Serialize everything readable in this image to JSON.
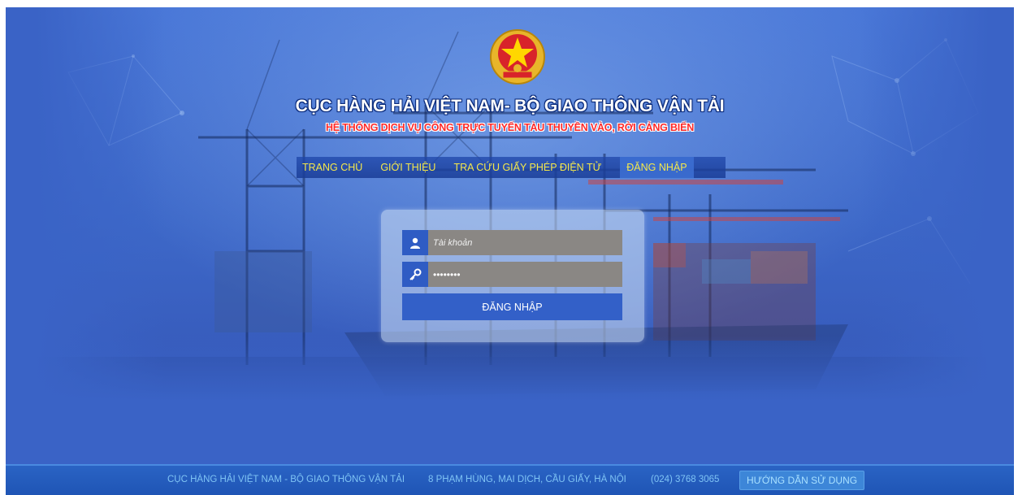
{
  "header": {
    "title": "CỤC HÀNG HẢI VIỆT NAM- BỘ GIAO THÔNG VẬN TẢI",
    "subtitle": "HỆ THỐNG DỊCH VỤ CÔNG TRỰC TUYẾN TÀU THUYỀN VÀO, RỜI CẢNG BIỂN"
  },
  "nav": {
    "items": [
      {
        "label": "TRANG CHỦ"
      },
      {
        "label": "GIỚI THIỆU"
      },
      {
        "label": "TRA CỨU GIẤY PHÉP ĐIỆN TỬ"
      },
      {
        "label": "ĐĂNG NHẬP"
      }
    ],
    "active_index": 3
  },
  "login": {
    "username_placeholder": "Tài khoản",
    "username_value": "",
    "password_value": "••••••••",
    "submit_label": "ĐĂNG NHẬP",
    "username_icon": "user-icon",
    "password_icon": "key-icon"
  },
  "footer": {
    "org": "CỤC HÀNG HẢI VIỆT NAM - BỘ GIAO THÔNG VẬN TẢI",
    "address": "8 PHẠM HÙNG, MAI DỊCH, CẦU GIẤY, HÀ NỘI",
    "phone": "(024) 3768 3065",
    "help_label": "HƯỚNG DẪN SỬ DỤNG"
  },
  "colors": {
    "page_bg": "#3a63c6",
    "nav_text": "#f5e84a",
    "subtitle_text": "#ff2a2a",
    "footer_text": "#7fc4f5",
    "button": "#3360c8",
    "input_bg": "#8a8784"
  }
}
